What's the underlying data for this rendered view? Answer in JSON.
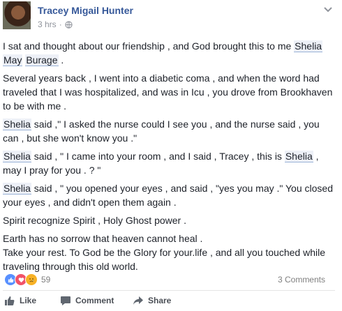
{
  "post": {
    "author": "Tracey Migail Hunter",
    "time": "3 hrs",
    "separator": "·",
    "paragraphs": [
      [
        {
          "text": "I sat and thought about our friendship , and God brought this to me "
        },
        {
          "text": "Shelia",
          "mention": true
        },
        {
          "text": " "
        },
        {
          "text": "May",
          "mention": true
        },
        {
          "text": " "
        },
        {
          "text": "Burage",
          "mention": true
        },
        {
          "text": " ."
        }
      ],
      [
        {
          "text": "Several years back , I went into a diabetic coma , and when the word had traveled that I was hospitalized, and was in Icu , you drove from Brookhaven to be with me ."
        }
      ],
      [
        {
          "text": "Shelia",
          "mention": true
        },
        {
          "text": " said ,\" I asked the nurse could I see you , and the nurse said , you can , but she won't know you .\""
        }
      ],
      [
        {
          "text": "Shelia",
          "mention": true
        },
        {
          "text": " said , \" I came into your room , and I said , Tracey , this is "
        },
        {
          "text": "Shelia",
          "mention": true
        },
        {
          "text": " , may I pray for you . ? \""
        }
      ],
      [
        {
          "text": "Shelia",
          "mention": true
        },
        {
          "text": " said , \" you opened your eyes , and said , \"yes you may .\" You closed your eyes , and didn't open them again ."
        }
      ],
      [
        {
          "text": "Spirit recognize Spirit , Holy Ghost power ."
        }
      ],
      [
        {
          "text": "Earth has no sorrow that heaven cannot heal ."
        },
        {
          "br": true
        },
        {
          "text": "Take your rest. To God be the Glory for your.life , and all you touched while traveling through this old world."
        }
      ]
    ]
  },
  "reactions": {
    "icons": [
      "like-reaction",
      "love-reaction",
      "sad-reaction"
    ],
    "count": "59",
    "comments": "3 Comments"
  },
  "actions": {
    "like": "Like",
    "comment": "Comment",
    "share": "Share"
  },
  "colors": {
    "link": "#365899",
    "mention_bg": "#edf0f7",
    "like": "#5890ff",
    "love": "#f25268",
    "sad": "#f7b125"
  }
}
